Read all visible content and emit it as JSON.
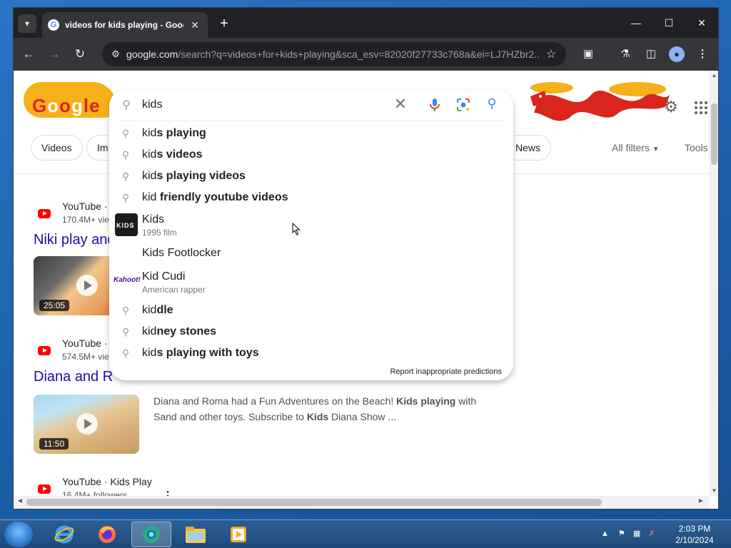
{
  "browser": {
    "tab_title": "videos for kids playing - Google Search",
    "url_host": "google.com",
    "url_rest": "/search?q=videos+for+kids+playing&sca_esv=82020f27733c768a&ei=LJ7HZbr2..."
  },
  "search": {
    "query": "kids",
    "suggestions": [
      {
        "prefix": "kid",
        "bold": "s playing"
      },
      {
        "prefix": "kid",
        "bold": "s videos"
      },
      {
        "prefix": "kid",
        "bold": "s playing videos"
      },
      {
        "prefix": "kid",
        "bold": " friendly youtube videos"
      }
    ],
    "entity_kids": {
      "title": "Kids",
      "subtitle": "1995 film"
    },
    "footlocker": "Kids Footlocker",
    "entity_cudi": {
      "title": "Kid Cudi",
      "subtitle": "American rapper"
    },
    "suggestions2": [
      {
        "prefix": "kid",
        "bold": "dle"
      },
      {
        "prefix": "kid",
        "bold": "ney stones"
      },
      {
        "prefix": "kid",
        "bold": "s playing with toys"
      }
    ],
    "report": "Report inappropriate predictions"
  },
  "filters": {
    "chips": [
      "Videos",
      "Im",
      "News"
    ],
    "all_filters": "All filters",
    "tools": "Tools"
  },
  "results": [
    {
      "site": "YouTube ·",
      "meta": "170.4M+ vie",
      "title": "Niki play and",
      "duration": "25:05"
    },
    {
      "site": "YouTube ·",
      "meta": "574.5M+ vie",
      "title": "Diana and R",
      "duration": "11:50",
      "snippet_parts": [
        "Diana and Roma had a Fun Adventures on the Beach! ",
        "Kids playing",
        " with Sand and other toys. Subscribe to ",
        "Kids",
        " Diana Show ..."
      ]
    },
    {
      "site": "YouTube · Kids Play",
      "meta": "16.4M+ followers"
    }
  ],
  "taskbar": {
    "time": "2:03 PM",
    "date": "2/10/2024"
  },
  "colors": {
    "link": "#1a0dab",
    "chrome_dark": "#202124",
    "youtube_red": "#ff0000"
  }
}
